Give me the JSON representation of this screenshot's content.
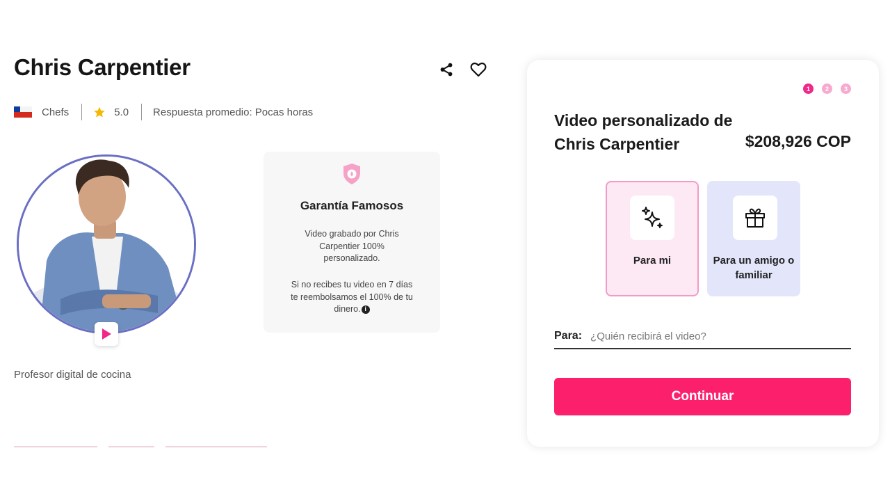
{
  "profile": {
    "name": "Chris Carpentier",
    "category": "Chefs",
    "rating": "5.0",
    "response_time": "Respuesta promedio: Pocas horas",
    "bio": "Profesor digital de cocina"
  },
  "icons": {
    "share": "share-icon",
    "favorite": "heart-icon",
    "flag": "chile-flag-icon",
    "rating": "star-icon",
    "play": "play-icon",
    "guarantee": "shield-icon",
    "for_me": "sparkles-icon",
    "for_friend": "gift-icon",
    "info": "info-icon"
  },
  "guarantee": {
    "title": "Garantía Famosos",
    "paragraph1": "Video grabado por Chris Carpentier 100% personalizado.",
    "paragraph2": "Si no recibes tu video en 7 días te reembolsamos el 100% de tu dinero.",
    "info_glyph": "i"
  },
  "order": {
    "steps": [
      "1",
      "2",
      "3"
    ],
    "active_step": 1,
    "title": "Video personalizado de Chris Carpentier",
    "price": "$208,926 COP",
    "options": [
      {
        "label": "Para mi",
        "selected": true
      },
      {
        "label": "Para un amigo o familiar",
        "selected": false
      }
    ],
    "to_label": "Para:",
    "to_placeholder": "¿Quién recibirá el video?",
    "to_value": "",
    "continue_label": "Continuar"
  },
  "colors": {
    "accent": "#fb1f6c",
    "step_active": "#f0288a",
    "step_inactive": "#f7a9cf",
    "option_me_bg": "#fde9f3",
    "option_friend_bg": "#e3e5fb",
    "avatar_ring": "#6a6fc4",
    "star": "#f5b800"
  }
}
